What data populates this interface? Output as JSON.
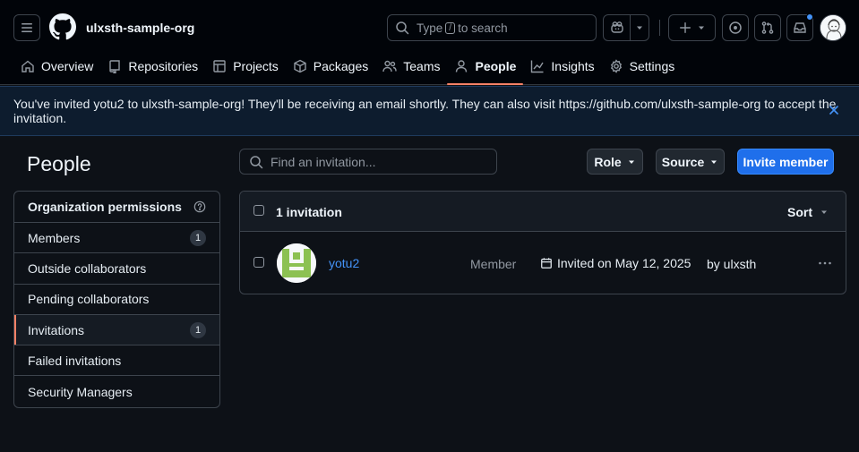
{
  "header": {
    "org_name": "ulxsth-sample-org",
    "search_prefix": "Type",
    "search_key": "/",
    "search_suffix": "to search"
  },
  "nav": [
    {
      "label": "Overview",
      "icon": "home-icon"
    },
    {
      "label": "Repositories",
      "icon": "repo-icon"
    },
    {
      "label": "Projects",
      "icon": "table-icon"
    },
    {
      "label": "Packages",
      "icon": "package-icon"
    },
    {
      "label": "Teams",
      "icon": "people-icon"
    },
    {
      "label": "People",
      "icon": "person-icon",
      "active": true
    },
    {
      "label": "Insights",
      "icon": "graph-icon"
    },
    {
      "label": "Settings",
      "icon": "gear-icon"
    }
  ],
  "flash": {
    "message": "You've invited yotu2 to ulxsth-sample-org! They'll be receiving an email shortly. They can also visit https://github.com/ulxsth-sample-org to accept the invitation."
  },
  "sidebar": {
    "title": "People",
    "items": [
      {
        "label": "Organization permissions"
      },
      {
        "label": "Members",
        "count": "1"
      },
      {
        "label": "Outside collaborators"
      },
      {
        "label": "Pending collaborators"
      },
      {
        "label": "Invitations",
        "count": "1",
        "selected": true
      },
      {
        "label": "Failed invitations"
      },
      {
        "label": "Security Managers"
      }
    ]
  },
  "toolbar": {
    "find_placeholder": "Find an invitation...",
    "role_label": "Role",
    "source_label": "Source",
    "invite_label": "Invite member"
  },
  "table": {
    "count_label": "1 invitation",
    "sort_label": "Sort",
    "rows": [
      {
        "login": "yotu2",
        "role": "Member",
        "invited": "Invited on May 12, 2025",
        "by": "by ulxsth"
      }
    ]
  },
  "colors": {
    "accent": "#f78166",
    "primary_button": "#1f6feb",
    "link": "#4493f8",
    "identicon": "#8cc152"
  }
}
